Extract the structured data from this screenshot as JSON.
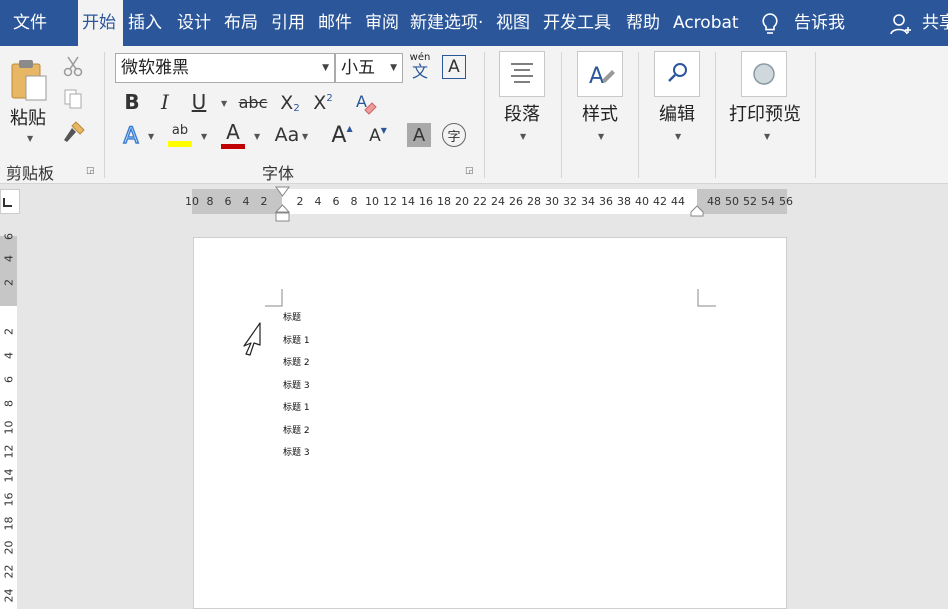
{
  "tabs": [
    {
      "label": "文件",
      "active": false
    },
    {
      "label": "开始",
      "active": true
    },
    {
      "label": "插入",
      "active": false
    },
    {
      "label": "设计",
      "active": false
    },
    {
      "label": "布局",
      "active": false
    },
    {
      "label": "引用",
      "active": false
    },
    {
      "label": "邮件",
      "active": false
    },
    {
      "label": "审阅",
      "active": false
    },
    {
      "label": "新建选项·",
      "active": false
    },
    {
      "label": "视图",
      "active": false
    },
    {
      "label": "开发工具",
      "active": false
    },
    {
      "label": "帮助",
      "active": false
    },
    {
      "label": "Acrobat",
      "active": false
    }
  ],
  "tell_me": "告诉我",
  "share": "共享",
  "clipboard": {
    "paste_label": "粘贴",
    "group_label": "剪贴板"
  },
  "font": {
    "name": "微软雅黑",
    "size": "小五",
    "phonetic_top": "wén",
    "phonetic_bottom": "文",
    "box_a": "A",
    "bold": "B",
    "italic": "I",
    "underline": "U",
    "strike": "abc",
    "subscript_base": "X",
    "subscript_mark": "2",
    "superscript_base": "X",
    "superscript_mark": "2",
    "effects": "A",
    "highlight": "ab",
    "color": "A",
    "case": "Aa",
    "grow": "A",
    "shrink": "A",
    "shade": "A",
    "enclose": "字",
    "group_label": "字体"
  },
  "paragraph_label": "段落",
  "styles_label": "样式",
  "editing_label": "编辑",
  "print_preview_label": "打印预览",
  "hruler_ticks": [
    "10",
    "8",
    "6",
    "4",
    "2",
    "2",
    "4",
    "6",
    "8",
    "10",
    "12",
    "14",
    "16",
    "18",
    "20",
    "22",
    "24",
    "26",
    "28",
    "30",
    "32",
    "34",
    "36",
    "38",
    "40",
    "42",
    "44",
    "48",
    "50",
    "52",
    "54",
    "56"
  ],
  "vruler_ticks": [
    "6",
    "4",
    "2",
    "2",
    "4",
    "6",
    "8",
    "10",
    "12",
    "14",
    "16",
    "18",
    "20",
    "22",
    "24"
  ],
  "doc_lines": [
    "标题",
    "标题 1",
    "标题 2",
    "标题 3",
    "标题 1",
    "标题 2",
    "标题 3"
  ],
  "colors": {
    "accent": "#2b579a",
    "ribbon_bg": "#f3f3f3",
    "font_color": "#c00000",
    "highlight": "#ffff00"
  }
}
